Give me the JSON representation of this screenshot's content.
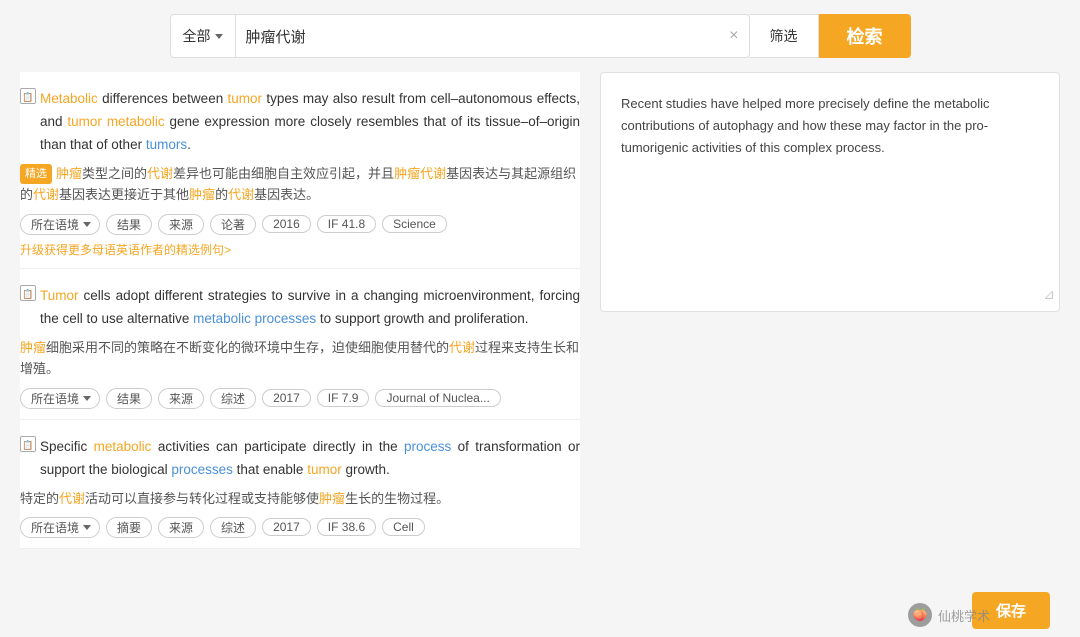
{
  "search": {
    "type_label": "全部",
    "query": "肿瘤代谢",
    "clear_icon": "×",
    "filter_label": "筛选",
    "search_label": "检索"
  },
  "preview": {
    "text": "Recent studies have helped more precisely define the metabolic contributions of autophagy and how these may factor in the pro-tumorigenic activities of this complex process."
  },
  "results": [
    {
      "id": 1,
      "en": "Metabolic differences between tumor types may also result from cell–autonomous effects, and tumor metabolic gene expression more closely resembles that of its tissue–of–origin than that of other tumors.",
      "cn": "精选 肿瘤类型之间的代谢差异也可能由细胞自主效应引起，并且肿瘤代谢基因表达与其起源组织的代谢基因表达更接近于其他肿瘤的代谢基因表达。",
      "context_label": "所在语境",
      "tags": [
        "结果",
        "来源",
        "论著",
        "2016",
        "IF 41.8",
        "Science"
      ],
      "upgrade_link": "升级获得更多母语英语作者的精选例句>"
    },
    {
      "id": 2,
      "en": "Tumor cells adopt different strategies to survive in a changing microenvironment, forcing the cell to use alternative metabolic processes to support growth and proliferation.",
      "cn": "肿瘤细胞采用不同的策略在不断变化的微环境中生存，迫使细胞使用替代的代谢过程来支持生长和增殖。",
      "context_label": "所在语境",
      "tags": [
        "结果",
        "来源",
        "综述",
        "2017",
        "IF 7.9",
        "Journal of Nuclea..."
      ]
    },
    {
      "id": 3,
      "en": "Specific metabolic activities can participate directly in the process of transformation or support the biological processes that enable tumor growth.",
      "cn": "特定的代谢活动可以直接参与转化过程或支持能够使肿瘤生长的生物过程。",
      "context_label": "所在语境",
      "tags": [
        "摘要",
        "来源",
        "综述",
        "2017",
        "IF 38.6",
        "Cell"
      ]
    }
  ],
  "bottom": {
    "save_label": "保存"
  },
  "watermark": {
    "label": "仙桃学术"
  }
}
